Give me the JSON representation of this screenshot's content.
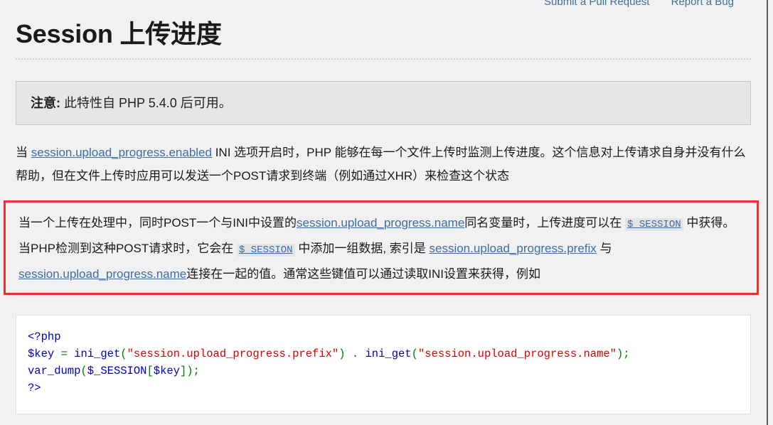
{
  "toplinks": [
    {
      "label": "Submit a Pull Request",
      "name": "submit-pull-request-link"
    },
    {
      "label": "Report a Bug",
      "name": "report-a-bug-link"
    }
  ],
  "title": "Session 上传进度",
  "note": {
    "label": "注意:",
    "text": " 此特性自 PHP 5.4.0 后可用。"
  },
  "intro": {
    "t1": "当 ",
    "link1": "session.upload_progress.enabled",
    "t2": " INI 选项开启时，PHP 能够在每一个文件上传时监测上传进度。这个信息对上传请求自身并没有什么帮助，但在文件上传时应用可以发送一个POST请求到终端（例如通过XHR）来检查这个状态"
  },
  "highlight": {
    "t1": "当一个上传在处理中，同时POST一个与INI中设置的",
    "link1": "session.upload_progress.name",
    "t2": "同名变量时，上传进度可以在 ",
    "code1": "$_SESSION",
    "t3": " 中获得。当PHP检测到这种POST请求时，它会在 ",
    "code2": "$_SESSION",
    "t4": " 中添加一组数据, 索引是 ",
    "link2": "session.upload_progress.prefix",
    "t5": " 与 ",
    "link3": "session.upload_progress.name",
    "t6": "连接在一起的值。通常这些键值可以通过读取INI设置来获得，例如"
  },
  "code": {
    "lines": [
      [
        {
          "t": "<?php",
          "c": "tok-tag"
        }
      ],
      [
        {
          "t": "$key",
          "c": "tok-var"
        },
        {
          "t": " ",
          "c": ""
        },
        {
          "t": "=",
          "c": "tok-punc"
        },
        {
          "t": " ",
          "c": ""
        },
        {
          "t": "ini_get",
          "c": "tok-fn"
        },
        {
          "t": "(",
          "c": "tok-punc"
        },
        {
          "t": "\"session.upload_progress.prefix\"",
          "c": "tok-str"
        },
        {
          "t": ")",
          "c": "tok-punc"
        },
        {
          "t": " ",
          "c": ""
        },
        {
          "t": ".",
          "c": "tok-punc"
        },
        {
          "t": " ",
          "c": ""
        },
        {
          "t": "ini_get",
          "c": "tok-fn"
        },
        {
          "t": "(",
          "c": "tok-punc"
        },
        {
          "t": "\"session.upload_progress.name\"",
          "c": "tok-str"
        },
        {
          "t": ")",
          "c": "tok-punc"
        },
        {
          "t": ";",
          "c": "tok-punc"
        }
      ],
      [
        {
          "t": "var_dump",
          "c": "tok-fn"
        },
        {
          "t": "(",
          "c": "tok-punc"
        },
        {
          "t": "$_SESSION",
          "c": "tok-var"
        },
        {
          "t": "[",
          "c": "tok-punc"
        },
        {
          "t": "$key",
          "c": "tok-var"
        },
        {
          "t": "]",
          "c": "tok-punc"
        },
        {
          "t": ")",
          "c": "tok-punc"
        },
        {
          "t": ";",
          "c": "tok-punc"
        }
      ],
      [
        {
          "t": "?>",
          "c": "tok-tag"
        }
      ]
    ]
  },
  "colors": {
    "page_background": "#f1f1f1",
    "note_background": "#e6e6e6",
    "link": "#3a6ea5",
    "highlight_border": "#f03030",
    "code_background": "#ffffff",
    "code_string": "#dd0000",
    "code_keyword": "#0000bb",
    "code_punctuation": "#007700"
  }
}
